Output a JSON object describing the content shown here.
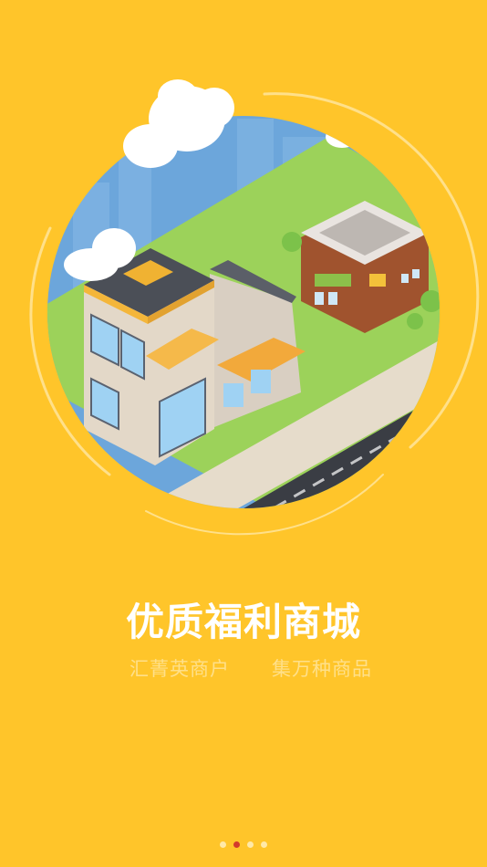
{
  "screen": {
    "title": "优质福利商城",
    "subtitle_left": "汇菁英商户",
    "subtitle_right": "集万种商品"
  },
  "pager": {
    "count": 4,
    "active_index": 1
  },
  "colors": {
    "background": "#FFC52A",
    "sky": "#6CA6DB",
    "grass": "#9CD25A",
    "road": "#3A3D44",
    "active_dot": "#D33A2C"
  }
}
